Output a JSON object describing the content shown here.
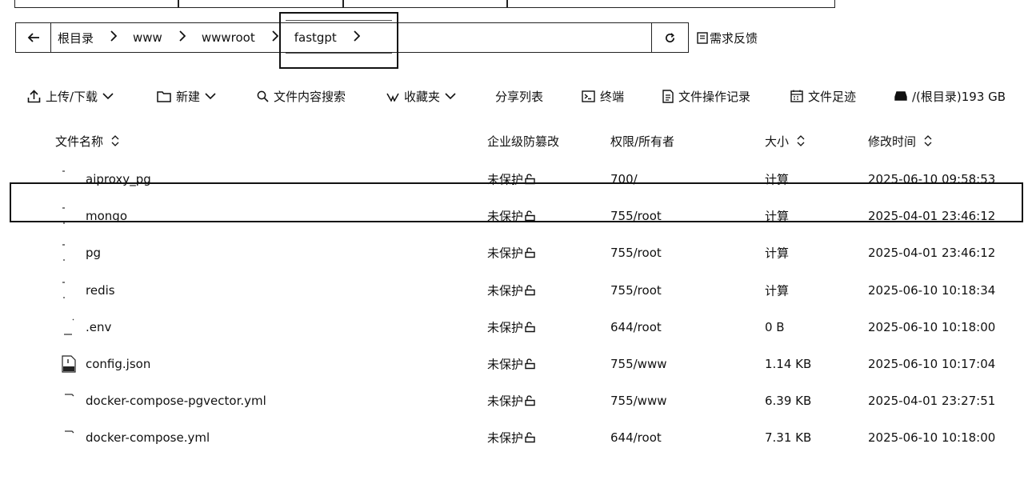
{
  "address_bar": {
    "crumbs": [
      "根目录",
      "www",
      "wwwroot",
      "fastgpt"
    ],
    "feedback_label": "需求反馈"
  },
  "toolbar": {
    "upload_label": "上传/下载",
    "new_label": "新建",
    "search_label": "文件内容搜索",
    "favorites_label": "收藏夹",
    "share_label": "分享列表",
    "terminal_label": "终端",
    "oplog_label": "文件操作记录",
    "footprint_label": "文件足迹",
    "disk_label": "/(根目录)193 GB"
  },
  "table": {
    "headers": {
      "name": "文件名称",
      "protect": "企业级防篡改",
      "perm": "权限/所有者",
      "size": "大小",
      "mtime": "修改时间"
    },
    "rows": [
      {
        "type": "folder",
        "name": "aiproxy_pg",
        "protect": "未保护",
        "perm": "700/",
        "size": "计算",
        "mtime": "2025-06-10 09:58:53"
      },
      {
        "type": "folder",
        "name": "mongo",
        "protect": "未保护",
        "perm": "755/root",
        "size": "计算",
        "mtime": "2025-04-01 23:46:12"
      },
      {
        "type": "folder",
        "name": "pg",
        "protect": "未保护",
        "perm": "755/root",
        "size": "计算",
        "mtime": "2025-04-01 23:46:12"
      },
      {
        "type": "folder",
        "name": "redis",
        "protect": "未保护",
        "perm": "755/root",
        "size": "计算",
        "mtime": "2025-06-10 10:18:34"
      },
      {
        "type": "file",
        "name": ".env",
        "protect": "未保护",
        "perm": "644/root",
        "size": "0 B",
        "mtime": "2025-06-10 10:18:00"
      },
      {
        "type": "json",
        "name": "config.json",
        "protect": "未保护",
        "perm": "755/www",
        "size": "1.14 KB",
        "mtime": "2025-06-10 10:17:04"
      },
      {
        "type": "file",
        "name": "docker-compose-pgvector.yml",
        "protect": "未保护",
        "perm": "755/www",
        "size": "6.39 KB",
        "mtime": "2025-04-01 23:27:51"
      },
      {
        "type": "file",
        "name": "docker-compose.yml",
        "protect": "未保护",
        "perm": "644/root",
        "size": "7.31 KB",
        "mtime": "2025-06-10 10:18:00"
      }
    ]
  }
}
